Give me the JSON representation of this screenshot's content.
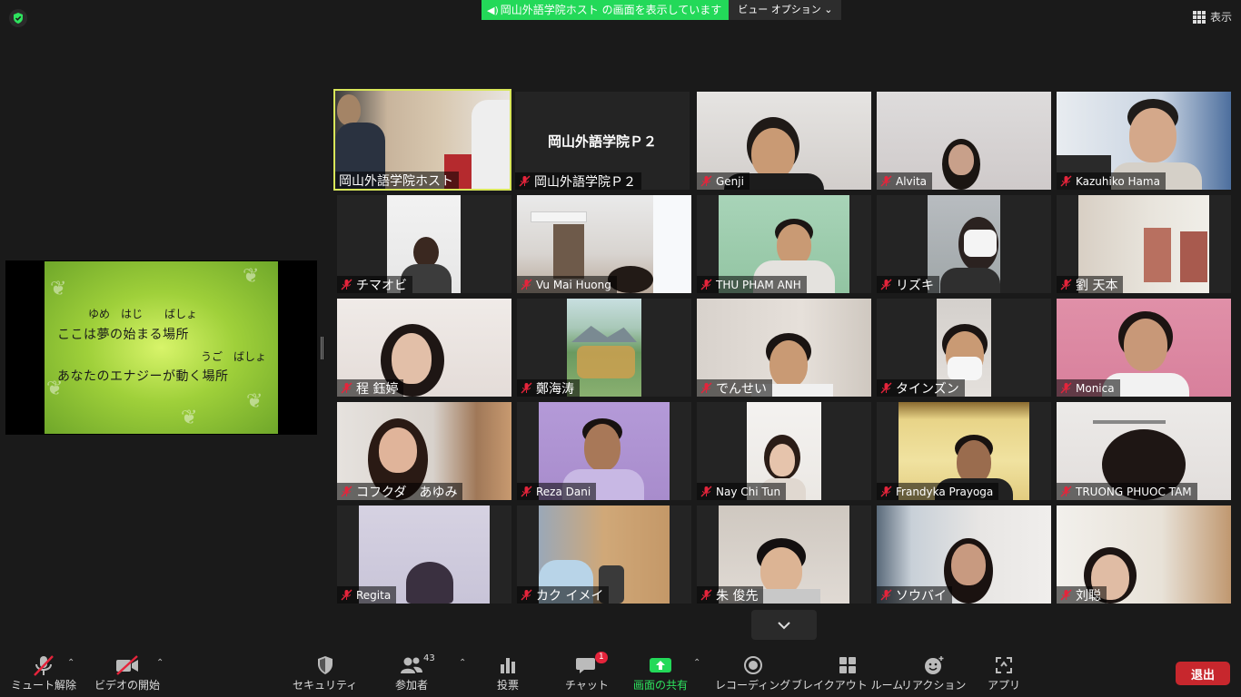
{
  "top": {
    "share_banner": "岡山外語学院ホスト の画面を表示しています",
    "view_options": "ビュー オプション",
    "display_label": "表示"
  },
  "slide": {
    "ruby1": "ゆめ　はじ　　ばしょ",
    "line1": "ここは夢の始まる場所",
    "ruby2": "うご　ばしょ",
    "line2": "あなたのエナジーが動く場所"
  },
  "participants": [
    {
      "name": "岡山外語学院ホスト",
      "muted": false,
      "active": true
    },
    {
      "name": "岡山外語学院Ｐ２",
      "muted": true,
      "title": "岡山外語学院Ｐ２"
    },
    {
      "name": "Genji",
      "muted": true
    },
    {
      "name": "Alvita",
      "muted": true
    },
    {
      "name": "Kazuhiko Hama",
      "muted": true
    },
    {
      "name": "チマオビ",
      "muted": true
    },
    {
      "name": "Vu Mai Huong",
      "muted": true
    },
    {
      "name": "THU PHAM ANH",
      "muted": true
    },
    {
      "name": "リズキ",
      "muted": true
    },
    {
      "name": "劉 天本",
      "muted": true
    },
    {
      "name": "程 鈺婷",
      "muted": true
    },
    {
      "name": "鄭海涛",
      "muted": true
    },
    {
      "name": "でんせい",
      "muted": true
    },
    {
      "name": "タインズン",
      "muted": true
    },
    {
      "name": "Monica",
      "muted": true
    },
    {
      "name": "コフクダ　あゆみ",
      "muted": true
    },
    {
      "name": "Reza Dani",
      "muted": true
    },
    {
      "name": "Nay Chi Tun",
      "muted": true
    },
    {
      "name": "Frandyka Prayoga",
      "muted": true
    },
    {
      "name": "TRUONG PHUOC TAM",
      "muted": true
    },
    {
      "name": "Regita",
      "muted": true
    },
    {
      "name": "カク イメイ",
      "muted": true
    },
    {
      "name": "朱 俊先",
      "muted": true
    },
    {
      "name": "ソウバイ",
      "muted": true
    },
    {
      "name": "刘聪",
      "muted": true
    }
  ],
  "toolbar": {
    "unmute": "ミュート解除",
    "start_video": "ビデオの開始",
    "security": "セキュリティ",
    "participants": "参加者",
    "participant_count": "43",
    "polls": "投票",
    "chat": "チャット",
    "chat_badge": "1",
    "share_screen": "画面の共有",
    "record": "レコーディング",
    "breakout": "ブレイクアウト ルーム",
    "reactions": "リアクション",
    "apps": "アプリ",
    "leave": "退出"
  },
  "colors": {
    "share_green": "#23d959",
    "active_border": "#d8e65a",
    "leave_red": "#c7272d",
    "muted_red": "#e5243b"
  }
}
